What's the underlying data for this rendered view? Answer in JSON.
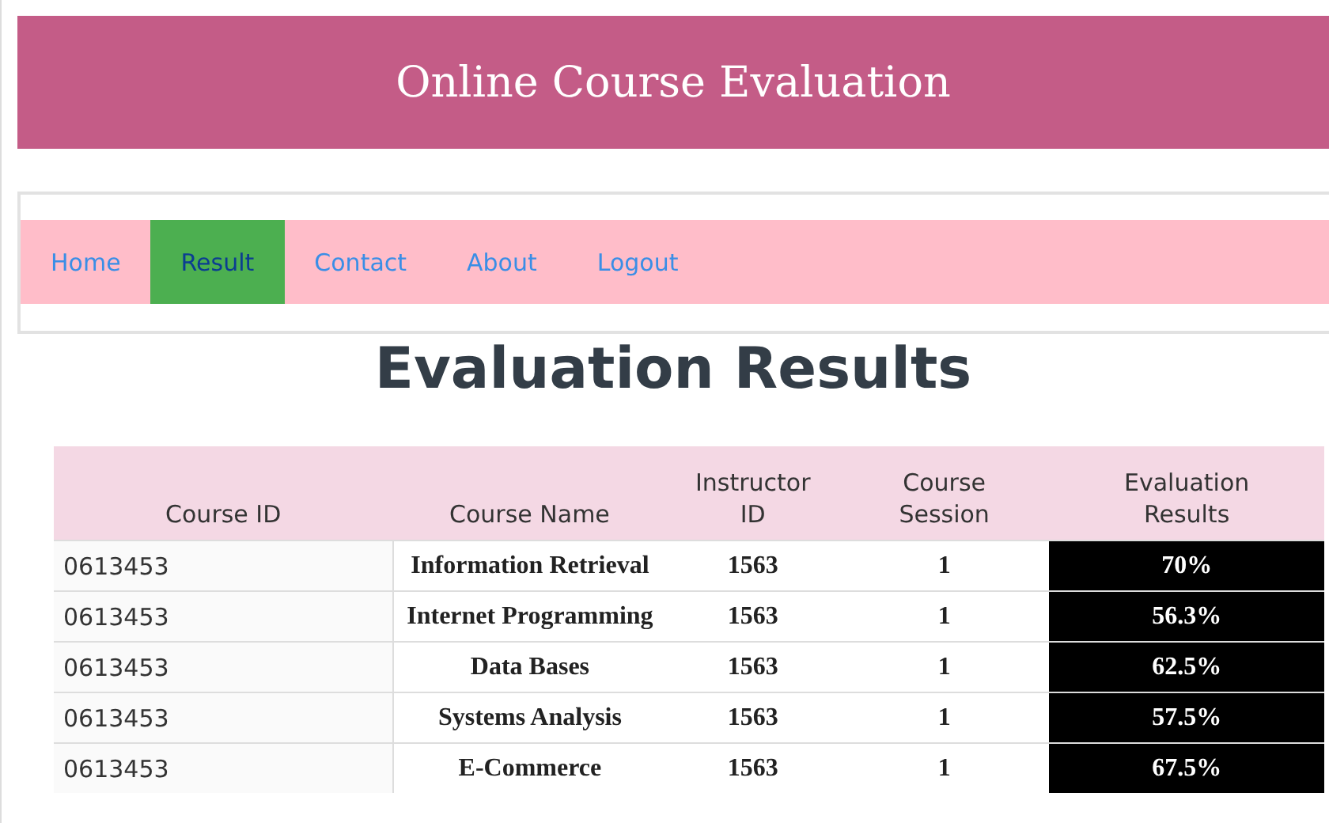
{
  "header": {
    "title": "Online Course Evaluation"
  },
  "nav": [
    {
      "label": "Home",
      "selected": false
    },
    {
      "label": "Result",
      "selected": true
    },
    {
      "label": "Contact",
      "selected": false
    },
    {
      "label": "About",
      "selected": false
    },
    {
      "label": "Logout",
      "selected": false
    }
  ],
  "heading": "Evaluation Results",
  "table": {
    "columns": [
      "Course ID",
      "Course Name",
      "Instructor ID",
      "Course Session",
      "Evaluation Results"
    ],
    "rows": [
      [
        "0613453",
        "Information Retrieval",
        "1563",
        "1",
        "70%"
      ],
      [
        "0613453",
        "Internet Programming",
        "1563",
        "1",
        "56.3%"
      ],
      [
        "0613453",
        "Data Bases",
        "1563",
        "1",
        "62.5%"
      ],
      [
        "0613453",
        "Systems Analysis",
        "1563",
        "1",
        "57.5%"
      ],
      [
        "0613453",
        "E-Commerce",
        "1563",
        "1",
        "67.5%"
      ]
    ]
  }
}
